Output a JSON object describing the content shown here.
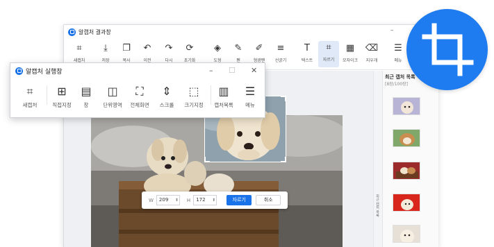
{
  "main_window": {
    "title": "알캡처 결과창",
    "controls": {
      "minimize": "–",
      "close": "✕"
    },
    "toolbar": [
      {
        "icon": "crop-new-icon",
        "label": "새캡처",
        "glyph": "⌗"
      },
      {
        "icon": "save-icon",
        "label": "저장",
        "glyph": "⤓"
      },
      {
        "icon": "copy-icon",
        "label": "복사",
        "glyph": "❐"
      },
      {
        "icon": "undo-icon",
        "label": "이전",
        "glyph": "↶"
      },
      {
        "icon": "redo-icon",
        "label": "다시",
        "glyph": "↷"
      },
      {
        "icon": "reset-icon",
        "label": "초기화",
        "glyph": "⟳"
      },
      {
        "icon": "shape-icon",
        "label": "도형",
        "glyph": "◈"
      },
      {
        "icon": "pen-icon",
        "label": "펜",
        "glyph": "✎"
      },
      {
        "icon": "highlighter-icon",
        "label": "형광펜",
        "glyph": "✐"
      },
      {
        "icon": "line-width-icon",
        "label": "선굵기",
        "glyph": "≡"
      },
      {
        "icon": "text-icon",
        "label": "텍스트",
        "glyph": "T"
      },
      {
        "icon": "crop-icon",
        "label": "자르기",
        "glyph": "⌗"
      },
      {
        "icon": "mosaic-icon",
        "label": "모자이크",
        "glyph": "▦"
      },
      {
        "icon": "eraser-icon",
        "label": "지우개",
        "glyph": "⌫"
      },
      {
        "icon": "menu-icon",
        "label": "메뉴",
        "glyph": "☰"
      }
    ],
    "crop_controls": {
      "width_label": "W",
      "width_value": "209",
      "height_label": "H",
      "height_value": "172",
      "apply_label": "자르기",
      "cancel_label": "취소"
    },
    "side_tab": "최근 캡처 목록",
    "recent_panel": {
      "title": "최근 캡처 목록",
      "count": "[8장/100장]"
    }
  },
  "launcher": {
    "title": "알캡처 실행창",
    "controls": {
      "minimize": "–",
      "maximize": "☐",
      "close": "✕"
    },
    "items": [
      {
        "icon": "new-capture-icon",
        "label": "새캡처",
        "glyph": "⌗"
      },
      {
        "icon": "manual-capture-icon",
        "label": "직접지정",
        "glyph": "⊞"
      },
      {
        "icon": "window-capture-icon",
        "label": "창",
        "glyph": "▤"
      },
      {
        "icon": "region-capture-icon",
        "label": "단위영역",
        "glyph": "◫"
      },
      {
        "icon": "fullscreen-capture-icon",
        "label": "전체화면",
        "glyph": "⛶"
      },
      {
        "icon": "scroll-capture-icon",
        "label": "스크롤",
        "glyph": "⇕"
      },
      {
        "icon": "size-capture-icon",
        "label": "크기지정",
        "glyph": "⬚"
      },
      {
        "icon": "capture-list-icon",
        "label": "캡처목록",
        "glyph": "▥"
      },
      {
        "icon": "menu-icon",
        "label": "메뉴",
        "glyph": "☰"
      }
    ]
  },
  "colors": {
    "accent": "#1a73e8",
    "badge": "#1e7cf0",
    "active_tool_bg": "#dfe9f7"
  },
  "badge_icon": "crop-icon"
}
